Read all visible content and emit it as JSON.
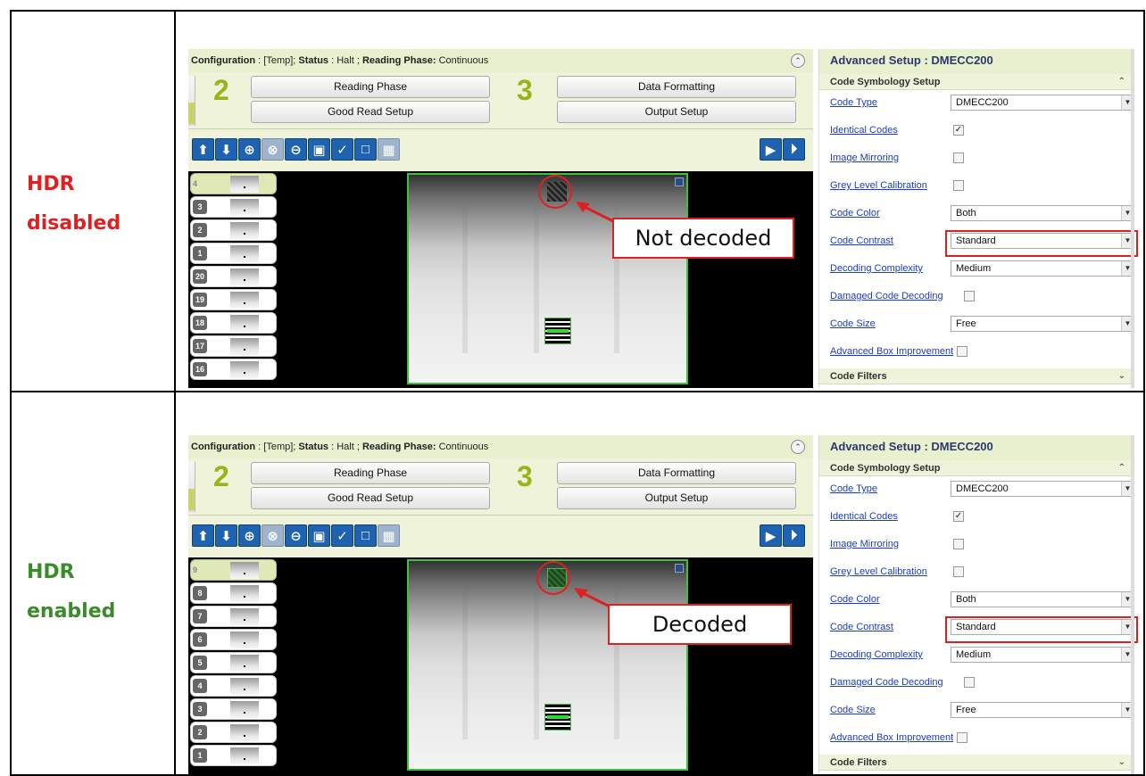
{
  "rows": [
    {
      "label_line1": "HDR",
      "label_line2": "disabled",
      "callout": "Not decoded",
      "active_thumb": "4",
      "thumbs": [
        "4",
        "3",
        "2",
        "1",
        "20",
        "19",
        "18",
        "17",
        "16"
      ]
    },
    {
      "label_line1": "HDR",
      "label_line2": "enabled",
      "callout": "Decoded",
      "active_thumb": "9",
      "thumbs": [
        "9",
        "8",
        "7",
        "6",
        "5",
        "4",
        "3",
        "2",
        "1"
      ]
    }
  ],
  "config": {
    "config_label": "Configuration",
    "config_value": ": [Temp];",
    "status_label": "Status",
    "status_value": ": Halt ;",
    "phase_label": "Reading Phase:",
    "phase_value": "Continuous"
  },
  "steps": {
    "step2_num": "2",
    "step3_num": "3",
    "reading_phase": "Reading Phase",
    "good_read": "Good Read Setup",
    "data_formatting": "Data Formatting",
    "output_setup": "Output Setup"
  },
  "advanced": {
    "title": "Advanced Setup :  DMECC200",
    "section": "Code Symbology Setup",
    "filters": "Code Filters",
    "code_type": "Code Type",
    "code_type_value": "DMECC200",
    "identical_codes": "Identical Codes",
    "image_mirroring": "Image Mirroring",
    "grey_level": "Grey Level Calibration",
    "code_color": "Code Color",
    "code_color_value": "Both",
    "code_contrast": "Code Contrast",
    "code_contrast_value": "Standard",
    "decoding_complexity": "Decoding Complexity",
    "decoding_complexity_value": "Medium",
    "damaged_code": "Damaged Code Decoding",
    "code_size": "Code Size",
    "code_size_value": "Free",
    "advanced_box": "Advanced Box Improvement",
    "check_mark": "✓"
  },
  "colors": {
    "disabled_label": "#e02020",
    "enabled_label": "#3a8c2a",
    "highlight": "#e02020",
    "decode_green": "#3fbf3f"
  }
}
